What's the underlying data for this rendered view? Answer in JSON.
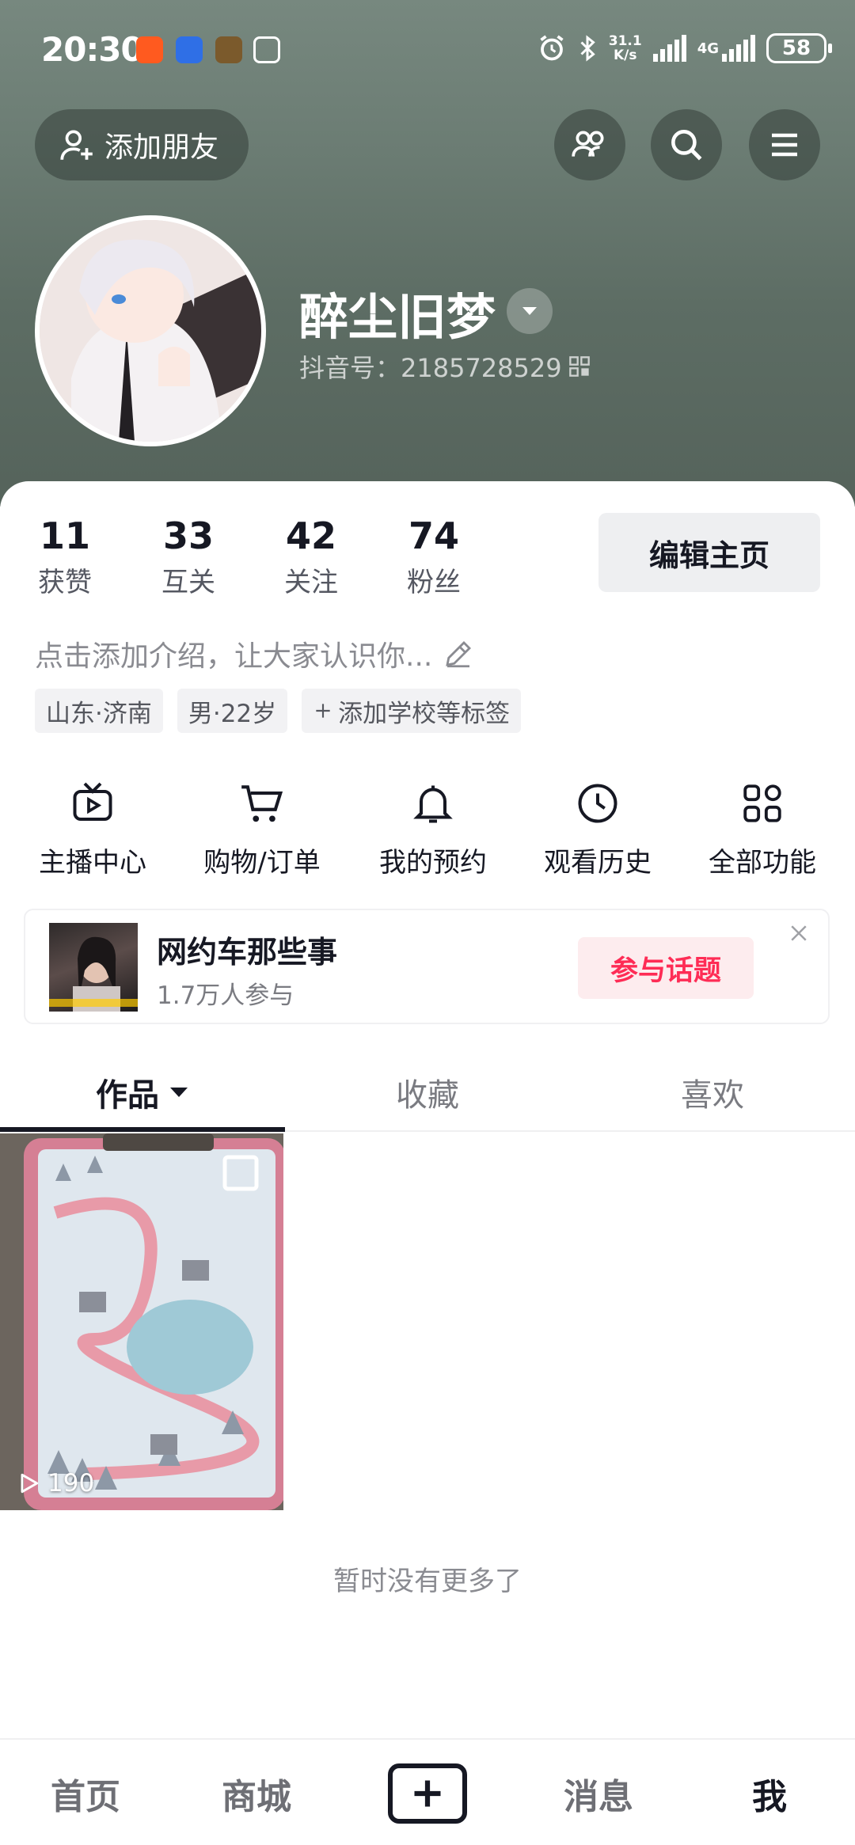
{
  "status_bar": {
    "time": "20:30",
    "net_speed_value": "31.1",
    "net_speed_unit": "K/s",
    "network": "4G",
    "battery": "58"
  },
  "header": {
    "add_friend_label": "添加朋友",
    "icons": [
      "friends-icon",
      "search-icon",
      "menu-icon"
    ]
  },
  "profile": {
    "nickname": "醉尘旧梦",
    "douyin_id": "抖音号：2185728529",
    "stats": [
      {
        "value": "11",
        "label": "获赞"
      },
      {
        "value": "33",
        "label": "互关"
      },
      {
        "value": "42",
        "label": "关注"
      },
      {
        "value": "74",
        "label": "粉丝"
      }
    ],
    "edit_label": "编辑主页",
    "bio_placeholder": "点击添加介绍，让大家认识你...",
    "tags": [
      "山东·济南",
      "男·22岁",
      "添加学校等标签"
    ]
  },
  "shortcuts": [
    {
      "label": "主播中心",
      "icon": "tv-icon"
    },
    {
      "label": "购物/订单",
      "icon": "cart-icon"
    },
    {
      "label": "我的预约",
      "icon": "bell-icon"
    },
    {
      "label": "观看历史",
      "icon": "clock-icon"
    },
    {
      "label": "全部功能",
      "icon": "grid-icon"
    }
  ],
  "topic": {
    "title": "网约车那些事",
    "participants": "1.7万人参与",
    "join_label": "参与话题"
  },
  "tabs": [
    {
      "label": "作品",
      "active": true
    },
    {
      "label": "收藏",
      "active": false
    },
    {
      "label": "喜欢",
      "active": false
    }
  ],
  "videos": [
    {
      "play_count": "190"
    }
  ],
  "empty_text": "暂时没有更多了",
  "bottom_nav": {
    "home": "首页",
    "mall": "商城",
    "messages": "消息",
    "me": "我"
  },
  "colors": {
    "accent": "#fe2c55",
    "header_bg": "#6b7c73",
    "text_primary": "#161823"
  }
}
